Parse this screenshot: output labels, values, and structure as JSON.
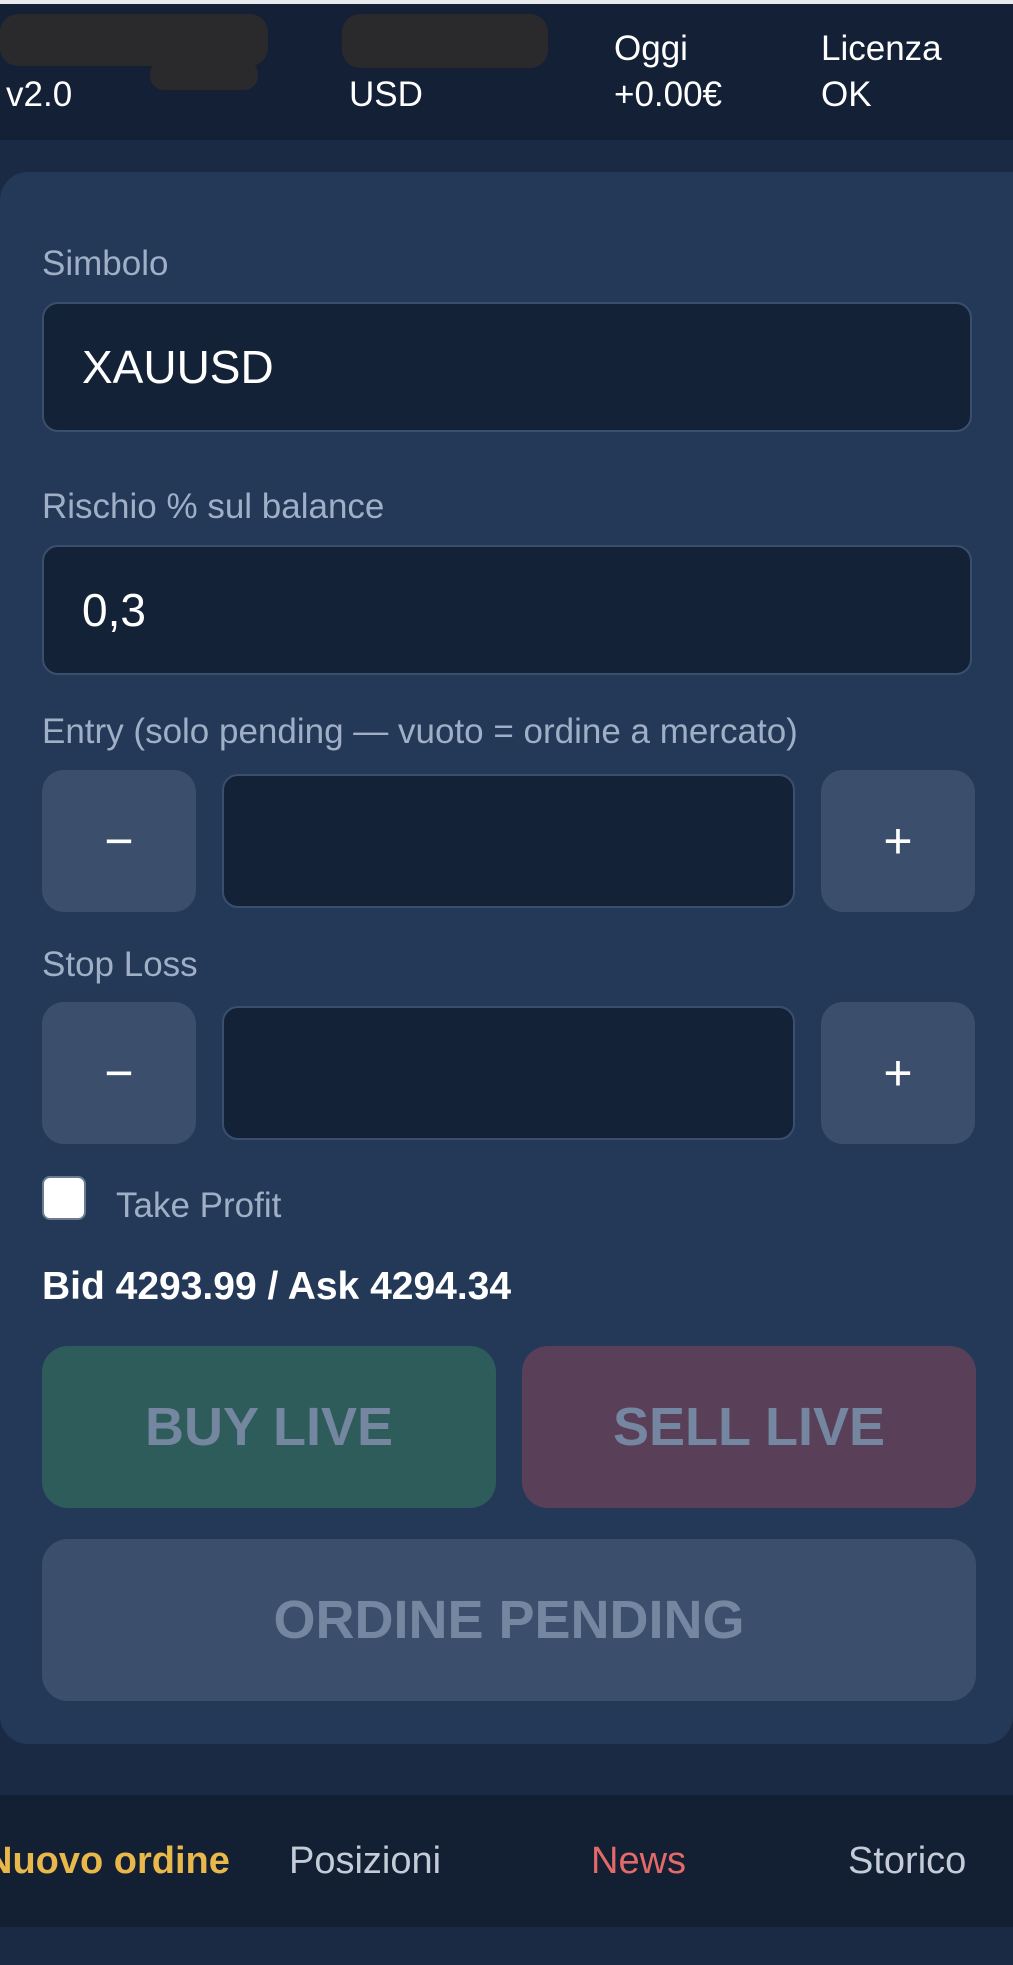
{
  "header": {
    "col1": {
      "line2": "v2.0"
    },
    "col2": {
      "line2": "USD"
    },
    "col3": {
      "line1": "Oggi",
      "line2": "+0.00€"
    },
    "col4": {
      "line1": "Licenza",
      "line2": "OK"
    }
  },
  "form": {
    "symbol": {
      "label": "Simbolo",
      "value": "XAUUSD"
    },
    "risk": {
      "label": "Rischio % sul balance",
      "value": "0,3"
    },
    "entry": {
      "label": "Entry (solo pending — vuoto = ordine a mercato)",
      "value": "",
      "minus": "−",
      "plus": "+"
    },
    "stop_loss": {
      "label": "Stop Loss",
      "value": "",
      "minus": "−",
      "plus": "+"
    },
    "take_profit": {
      "label": "Take Profit",
      "checked": false
    }
  },
  "quote": {
    "text": "Bid 4293.99 / Ask 4294.34"
  },
  "actions": {
    "buy": "BUY LIVE",
    "sell": "SELL LIVE",
    "pending": "ORDINE PENDING"
  },
  "nav": {
    "items": [
      {
        "label": "Nuovo ordine",
        "color": "#e8b84a"
      },
      {
        "label": "Posizioni",
        "color": "#c4ccd8"
      },
      {
        "label": "News",
        "color": "#e46a6a"
      },
      {
        "label": "Storico",
        "color": "#c4ccd8"
      }
    ]
  },
  "colors": {
    "background": "#1b2a44",
    "card": "#243958",
    "input": "#132237",
    "buy": "#2e5c5a",
    "sell": "#593f58",
    "neutral_button": "#3b4f6d"
  }
}
